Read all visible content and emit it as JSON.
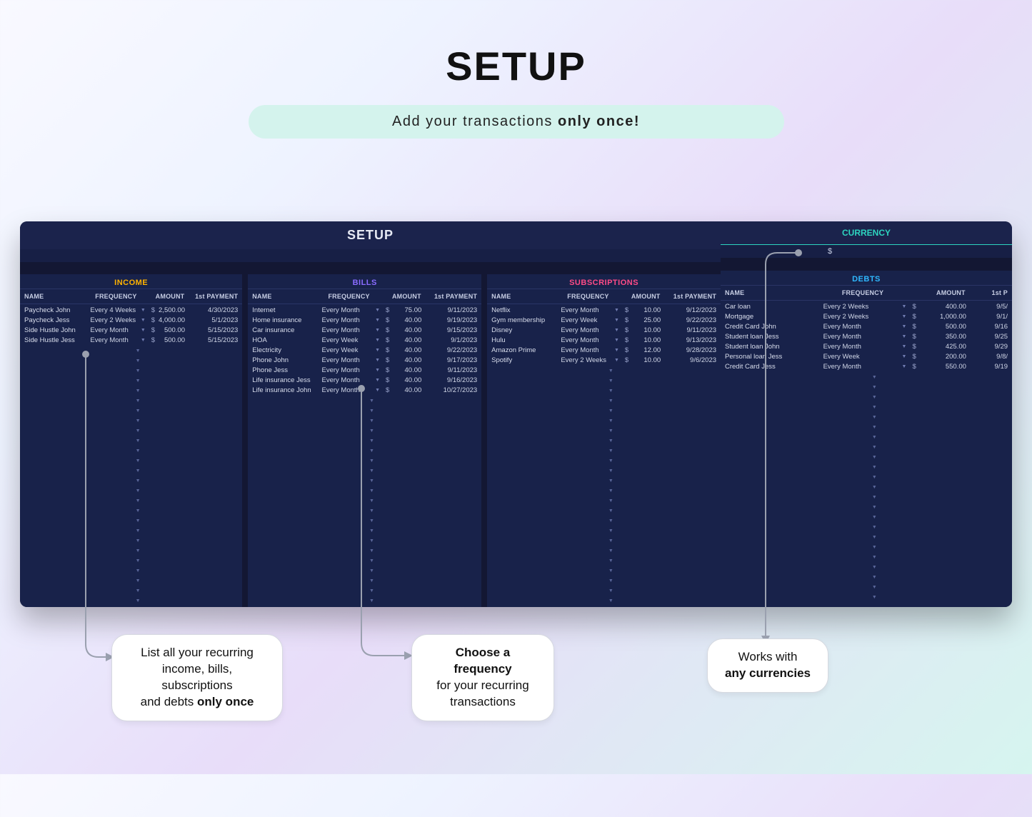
{
  "page": {
    "title": "SETUP",
    "subtitle_prefix": "Add your transactions ",
    "subtitle_bold": "only once!"
  },
  "setup_header": "SETUP",
  "currency_label": "CURRENCY",
  "currency_symbol": "$",
  "columns": {
    "name": "NAME",
    "frequency": "FREQUENCY",
    "amount": "AMOUNT",
    "first": "1st PAYMENT",
    "first_short": "1st P"
  },
  "panels": {
    "income": {
      "title": "INCOME",
      "rows": [
        {
          "name": "Paycheck John",
          "freq": "Every 4 Weeks",
          "amt": "2,500.00",
          "first": "4/30/2023"
        },
        {
          "name": "Paycheck Jess",
          "freq": "Every 2 Weeks",
          "amt": "4,000.00",
          "first": "5/1/2023"
        },
        {
          "name": "Side Hustle John",
          "freq": "Every Month",
          "amt": "500.00",
          "first": "5/15/2023"
        },
        {
          "name": "Side Hustle Jess",
          "freq": "Every Month",
          "amt": "500.00",
          "first": "5/15/2023"
        }
      ]
    },
    "bills": {
      "title": "BILLS",
      "rows": [
        {
          "name": "Internet",
          "freq": "Every Month",
          "amt": "75.00",
          "first": "9/11/2023"
        },
        {
          "name": "Home insurance",
          "freq": "Every Month",
          "amt": "40.00",
          "first": "9/19/2023"
        },
        {
          "name": "Car insurance",
          "freq": "Every Month",
          "amt": "40.00",
          "first": "9/15/2023"
        },
        {
          "name": "HOA",
          "freq": "Every Week",
          "amt": "40.00",
          "first": "9/1/2023"
        },
        {
          "name": "Electricity",
          "freq": "Every Week",
          "amt": "40.00",
          "first": "9/22/2023"
        },
        {
          "name": "Phone John",
          "freq": "Every Month",
          "amt": "40.00",
          "first": "9/17/2023"
        },
        {
          "name": "Phone Jess",
          "freq": "Every Month",
          "amt": "40.00",
          "first": "9/11/2023"
        },
        {
          "name": "Life insurance Jess",
          "freq": "Every Month",
          "amt": "40.00",
          "first": "9/16/2023"
        },
        {
          "name": "Life insurance John",
          "freq": "Every Month",
          "amt": "40.00",
          "first": "10/27/2023"
        }
      ]
    },
    "subs": {
      "title": "SUBSCRIPTIONS",
      "rows": [
        {
          "name": "Netflix",
          "freq": "Every Month",
          "amt": "10.00",
          "first": "9/12/2023"
        },
        {
          "name": "Gym membership",
          "freq": "Every Week",
          "amt": "25.00",
          "first": "9/22/2023"
        },
        {
          "name": "Disney",
          "freq": "Every Month",
          "amt": "10.00",
          "first": "9/11/2023"
        },
        {
          "name": "Hulu",
          "freq": "Every Month",
          "amt": "10.00",
          "first": "9/13/2023"
        },
        {
          "name": "Amazon Prime",
          "freq": "Every Month",
          "amt": "12.00",
          "first": "9/28/2023"
        },
        {
          "name": "Spotify",
          "freq": "Every 2 Weeks",
          "amt": "10.00",
          "first": "9/6/2023"
        }
      ]
    },
    "debts": {
      "title": "DEBTS",
      "rows": [
        {
          "name": "Car loan",
          "freq": "Every 2 Weeks",
          "amt": "400.00",
          "first": "9/5/"
        },
        {
          "name": "Mortgage",
          "freq": "Every 2 Weeks",
          "amt": "1,000.00",
          "first": "9/1/"
        },
        {
          "name": "Credit Card John",
          "freq": "Every Month",
          "amt": "500.00",
          "first": "9/16"
        },
        {
          "name": "Student loan Jess",
          "freq": "Every Month",
          "amt": "350.00",
          "first": "9/25"
        },
        {
          "name": "Student loan John",
          "freq": "Every Month",
          "amt": "425.00",
          "first": "9/29"
        },
        {
          "name": "Personal loan Jess",
          "freq": "Every Week",
          "amt": "200.00",
          "first": "9/8/"
        },
        {
          "name": "Credit Card Jess",
          "freq": "Every Month",
          "amt": "550.00",
          "first": "9/19"
        }
      ]
    }
  },
  "callouts": {
    "c1_a": "List all your recurring",
    "c1_b": "income, bills, subscriptions",
    "c1_c_pre": "and debts ",
    "c1_c_bold": "only once",
    "c2_a_bold": "Choose a frequency",
    "c2_b": "for your recurring",
    "c2_c": "transactions",
    "c3_a": "Works with",
    "c3_b_bold": "any currencies"
  }
}
